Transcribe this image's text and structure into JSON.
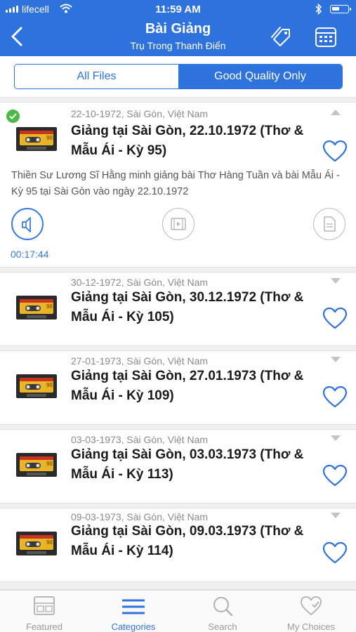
{
  "status_bar": {
    "carrier": "lifecell",
    "time": "11:59 AM"
  },
  "nav": {
    "title": "Bài Giảng",
    "subtitle": "Trụ Trong Thanh Điển"
  },
  "segment": {
    "all_files": "All Files",
    "good_quality": "Good Quality Only",
    "selected": "Good Quality Only"
  },
  "items": [
    {
      "meta": "22-10-1972, Sài Gòn, Việt Nam",
      "title": "Giảng tại Sài Gòn, 22.10.1972 (Thơ & Mẫu Ái - Kỳ 95)",
      "expanded": true,
      "downloaded": true,
      "description": "Thiền Sư Lương Sĩ Hằng minh giảng bài Thơ Hàng Tuần và bài Mẫu Ái - Kỳ 95 tại Sài Gòn vào ngày 22.10.1972",
      "duration": "00:17:44"
    },
    {
      "meta": "30-12-1972, Sài Gòn, Việt Nam",
      "title": "Giảng tại Sài Gòn, 30.12.1972 (Thơ & Mẫu Ái - Kỳ 105)"
    },
    {
      "meta": "27-01-1973, Sài Gòn, Việt Nam",
      "title": "Giảng tại Sài Gòn, 27.01.1973 (Thơ & Mẫu Ái - Kỳ 109)"
    },
    {
      "meta": "03-03-1973, Sài Gòn, Việt Nam",
      "title": "Giảng tại Sài Gòn, 03.03.1973 (Thơ & Mẫu Ái - Kỳ 113)"
    },
    {
      "meta": "09-03-1973, Sài Gòn, Việt Nam",
      "title": "Giảng tại Sài Gòn, 09.03.1973 (Thơ & Mẫu Ái - Kỳ 114)"
    }
  ],
  "tabbar": {
    "featured": "Featured",
    "categories": "Categories",
    "search": "Search",
    "my_choices": "My Choices",
    "active": "Categories"
  },
  "colors": {
    "brand": "#2e72de",
    "check": "#4cb848",
    "meta": "#8a8a8a"
  },
  "icons": {
    "back": "chevron-left-icon",
    "tags": "tag-icon",
    "calendar": "calendar-icon",
    "audio": "speaker-icon",
    "video": "film-icon",
    "document": "document-icon",
    "favorite": "heart-icon"
  }
}
